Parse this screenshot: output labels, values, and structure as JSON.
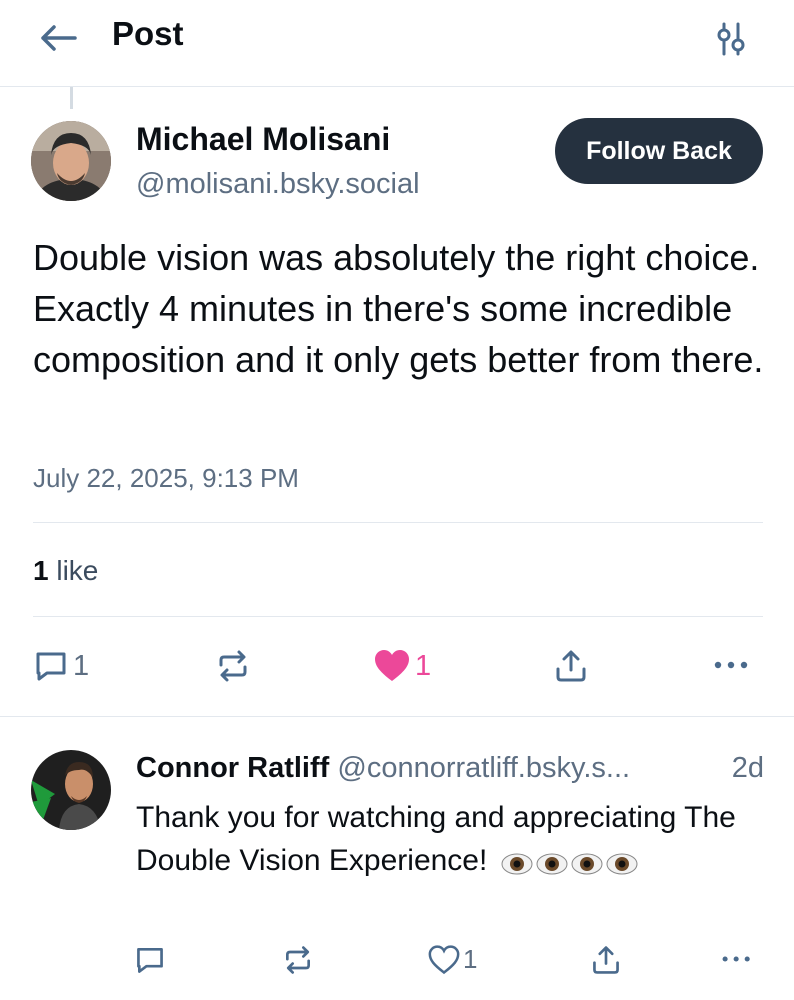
{
  "header": {
    "title": "Post",
    "icons": {
      "back": "arrow-left-icon",
      "settings": "sliders-icon"
    }
  },
  "post": {
    "author_name": "Michael Molisani",
    "author_handle": "@molisani.bsky.social",
    "follow_label": "Follow Back",
    "text": "Double vision was absolutely the right choice. Exactly 4 minutes in there's some incredible composition and it only gets better from there.",
    "date": "July 22, 2025, 9:13 PM",
    "likes_count": "1",
    "likes_label": "like",
    "actions": {
      "reply_count": "1",
      "like_count": "1"
    }
  },
  "reply": {
    "author_name": "Connor Ratliff",
    "author_handle": "@connorratliff.bsky.s...",
    "time": "2d",
    "text": "Thank you for watching and appreciating The Double Vision Experience!",
    "emoji": "👁️👁️👁️👁️",
    "actions": {
      "like_count": "1"
    }
  },
  "colors": {
    "accent_dark": "#25313f",
    "muted": "#5d6e82",
    "like_pink": "#ec4899",
    "divider": "#e3e8ee"
  }
}
